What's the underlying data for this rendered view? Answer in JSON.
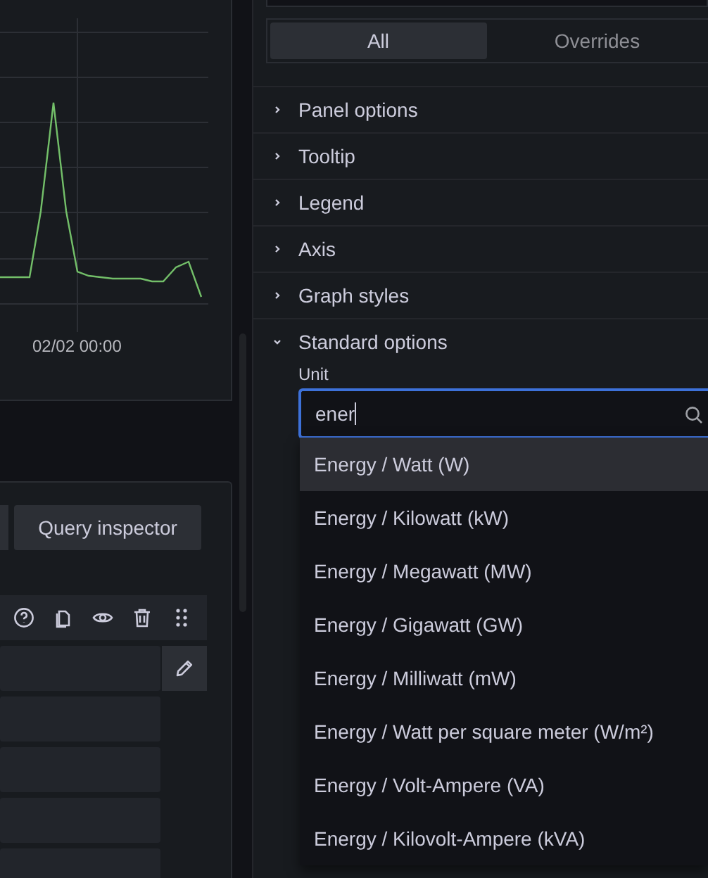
{
  "graph_panel": {
    "x_label": "02/02 00:00"
  },
  "query_panel": {
    "buttons": [
      "Query inspector"
    ]
  },
  "options_pane": {
    "tabs": [
      {
        "label": "All",
        "selected": true
      },
      {
        "label": "Overrides",
        "selected": false
      }
    ],
    "sections": [
      {
        "label": "Panel options",
        "expanded": false
      },
      {
        "label": "Tooltip",
        "expanded": false
      },
      {
        "label": "Legend",
        "expanded": false
      },
      {
        "label": "Axis",
        "expanded": false
      },
      {
        "label": "Graph styles",
        "expanded": false
      },
      {
        "label": "Standard options",
        "expanded": true
      }
    ],
    "unit_field": {
      "label": "Unit",
      "value": "ener"
    },
    "dropdown": [
      {
        "label": "Energy / Watt (W)",
        "selected": true
      },
      {
        "label": "Energy / Kilowatt (kW)",
        "selected": false
      },
      {
        "label": "Energy / Megawatt (MW)",
        "selected": false
      },
      {
        "label": "Energy / Gigawatt (GW)",
        "selected": false
      },
      {
        "label": "Energy / Milliwatt (mW)",
        "selected": false
      },
      {
        "label": "Energy / Watt per square meter (W/m²)",
        "selected": false
      },
      {
        "label": "Energy / Volt-Ampere (VA)",
        "selected": false
      },
      {
        "label": "Energy / Kilovolt-Ampere (kVA)",
        "selected": false
      }
    ]
  }
}
